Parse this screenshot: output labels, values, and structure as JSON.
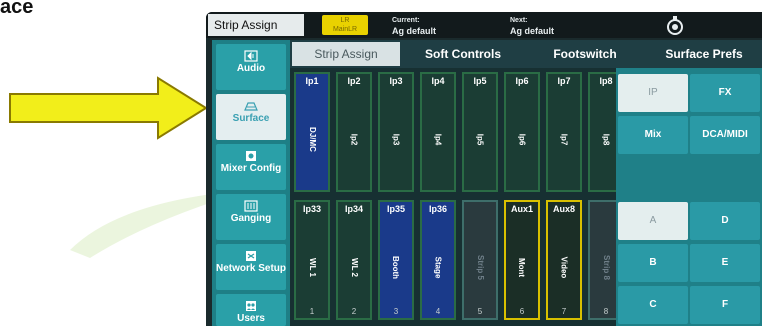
{
  "caption_fragment": "ace",
  "colors": {
    "accent": "#2aa0a8",
    "highlight": "#e9d200"
  },
  "header": {
    "screen_title": "Strip Assign",
    "mix_badge": [
      "LR",
      "MainLR"
    ],
    "current_label": "Current:",
    "current_value": "Ag default",
    "next_label": "Next:",
    "next_value": "Ag default",
    "icon": "settings-dial-icon"
  },
  "nav": [
    {
      "label": "Audio",
      "icon": "audio-icon"
    },
    {
      "label": "Surface",
      "icon": "surface-icon",
      "active": true
    },
    {
      "label": "Mixer Config",
      "icon": "mixer-config-icon"
    },
    {
      "label": "Ganging",
      "icon": "ganging-icon"
    },
    {
      "label": "Network Setup",
      "icon": "network-icon"
    },
    {
      "label": "Users",
      "icon": "users-icon"
    }
  ],
  "tabs": [
    {
      "label": "Strip Assign",
      "active": true
    },
    {
      "label": "Soft Controls"
    },
    {
      "label": "Footswitch"
    },
    {
      "label": "Surface Prefs"
    }
  ],
  "strips_top": [
    {
      "top": "Ip1",
      "name": "DJ/MC"
    },
    {
      "top": "Ip2",
      "name": "Ip2"
    },
    {
      "top": "Ip3",
      "name": "Ip3"
    },
    {
      "top": "Ip4",
      "name": "Ip4"
    },
    {
      "top": "Ip5",
      "name": "Ip5"
    },
    {
      "top": "Ip6",
      "name": "Ip6"
    },
    {
      "top": "Ip7",
      "name": "Ip7"
    },
    {
      "top": "Ip8",
      "name": "Ip8"
    }
  ],
  "strips_bottom": [
    {
      "top": "Ip33",
      "name": "WL 1",
      "num": "1"
    },
    {
      "top": "Ip34",
      "name": "WL 2",
      "num": "2"
    },
    {
      "top": "Ip35",
      "name": "Booth",
      "num": "3"
    },
    {
      "top": "Ip36",
      "name": "Stage",
      "num": "4"
    },
    {
      "top": "",
      "name": "Strip 5",
      "num": "5"
    },
    {
      "top": "Aux1",
      "name": "Mont",
      "num": "6"
    },
    {
      "top": "Aux8",
      "name": "Video",
      "num": "7"
    },
    {
      "top": "",
      "name": "Strip 8",
      "num": "8"
    }
  ],
  "layer_buttons_top": [
    "IP",
    "FX",
    "Mix",
    "DCA/MIDI"
  ],
  "layer_buttons_bottom": [
    "A",
    "D",
    "B",
    "E",
    "C",
    "F"
  ]
}
